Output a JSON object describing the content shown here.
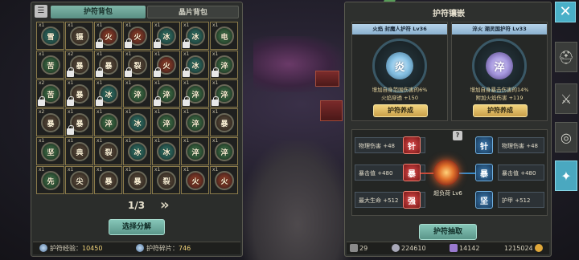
{
  "left_panel": {
    "tabs": [
      {
        "label": "护符背包",
        "active": true
      },
      {
        "label": "晶片背包",
        "active": false
      }
    ],
    "grid": [
      {
        "count": "x1",
        "glyph": "雪",
        "element": "water",
        "locked": false
      },
      {
        "count": "x1",
        "glyph": "镊",
        "element": "dark",
        "locked": false
      },
      {
        "count": "x1",
        "glyph": "火",
        "element": "fire",
        "locked": true
      },
      {
        "count": "x1",
        "glyph": "火",
        "element": "fire",
        "locked": true
      },
      {
        "count": "x1",
        "glyph": "冰",
        "element": "water",
        "locked": true
      },
      {
        "count": "x1",
        "glyph": "冰",
        "element": "water",
        "locked": true
      },
      {
        "count": "x1",
        "glyph": "电",
        "element": "thunder",
        "locked": false
      },
      {
        "count": "x1",
        "glyph": "苦",
        "element": "thunder",
        "locked": false
      },
      {
        "count": "x2",
        "glyph": "暴",
        "element": "dark",
        "locked": true
      },
      {
        "count": "x1",
        "glyph": "暴",
        "element": "dark",
        "locked": true
      },
      {
        "count": "x1",
        "glyph": "裂",
        "element": "dark",
        "locked": true
      },
      {
        "count": "x1",
        "glyph": "火",
        "element": "fire",
        "locked": true
      },
      {
        "count": "x1",
        "glyph": "冰",
        "element": "water",
        "locked": true
      },
      {
        "count": "x1",
        "glyph": "淬",
        "element": "thunder",
        "locked": true
      },
      {
        "count": "x2",
        "glyph": "苦",
        "element": "thunder",
        "locked": true
      },
      {
        "count": "x1",
        "glyph": "暴",
        "element": "dark",
        "locked": true
      },
      {
        "count": "x1",
        "glyph": "冰",
        "element": "water",
        "locked": true
      },
      {
        "count": "x1",
        "glyph": "淬",
        "element": "thunder",
        "locked": false
      },
      {
        "count": "x1",
        "glyph": "淬",
        "element": "thunder",
        "locked": true
      },
      {
        "count": "x1",
        "glyph": "淬",
        "element": "thunder",
        "locked": true
      },
      {
        "count": "x1",
        "glyph": "淬",
        "element": "thunder",
        "locked": true
      },
      {
        "count": "x2",
        "glyph": "暴",
        "element": "dark",
        "locked": false
      },
      {
        "count": "x1",
        "glyph": "暴",
        "element": "dark",
        "locked": true
      },
      {
        "count": "x1",
        "glyph": "淬",
        "element": "thunder",
        "locked": false
      },
      {
        "count": "x1",
        "glyph": "冰",
        "element": "water",
        "locked": false
      },
      {
        "count": "x1",
        "glyph": "淬",
        "element": "thunder",
        "locked": false
      },
      {
        "count": "x1",
        "glyph": "淬",
        "element": "thunder",
        "locked": false
      },
      {
        "count": "x1",
        "glyph": "暴",
        "element": "dark",
        "locked": false
      },
      {
        "count": "x1",
        "glyph": "坚",
        "element": "thunder",
        "locked": false
      },
      {
        "count": "x1",
        "glyph": "典",
        "element": "dark",
        "locked": false
      },
      {
        "count": "x1",
        "glyph": "裂",
        "element": "dark",
        "locked": false
      },
      {
        "count": "x1",
        "glyph": "冰",
        "element": "water",
        "locked": false
      },
      {
        "count": "x1",
        "glyph": "冰",
        "element": "water",
        "locked": false
      },
      {
        "count": "x1",
        "glyph": "淬",
        "element": "thunder",
        "locked": false
      },
      {
        "count": "x1",
        "glyph": "淬",
        "element": "thunder",
        "locked": false
      },
      {
        "count": "x1",
        "glyph": "先",
        "element": "thunder",
        "locked": false
      },
      {
        "count": "x1",
        "glyph": "尖",
        "element": "dark",
        "locked": false
      },
      {
        "count": "x1",
        "glyph": "暴",
        "element": "dark",
        "locked": false
      },
      {
        "count": "x1",
        "glyph": "暴",
        "element": "dark",
        "locked": false
      },
      {
        "count": "x1",
        "glyph": "裂",
        "element": "dark",
        "locked": false
      },
      {
        "count": "x1",
        "glyph": "火",
        "element": "fire",
        "locked": false
      },
      {
        "count": "x1",
        "glyph": "火",
        "element": "fire",
        "locked": false
      }
    ],
    "page_indicator": "1/3",
    "select_button": "选择分解",
    "footer": {
      "exp_label": "护符经验：",
      "exp_value": "10450",
      "shard_label": "护符碎片：",
      "shard_value": "746"
    }
  },
  "right_panel": {
    "title": "护符镶嵌",
    "slots": [
      {
        "name": "火焰 封魔人护符 Lv36",
        "glyph": "炎",
        "effect_1": "增加自身范围伤害的6%",
        "effect_2": "火焰穿透 +150",
        "button": "护符养成"
      },
      {
        "name": "淬火 潮灵国护符 Lv33",
        "glyph": "淬",
        "effect_1": "增加自身暴击伤害的14%",
        "effect_2": "附加火焰伤害 +119",
        "button": "护符养成"
      }
    ],
    "left_stats": [
      "物理伤害 +48",
      "暴击值 +480",
      "最大生命 +512"
    ],
    "right_stats": [
      "物理伤害 +48",
      "暴击值 +480",
      "护甲 +512"
    ],
    "left_runes": [
      "针",
      "暴",
      "强"
    ],
    "right_runes": [
      "针",
      "暴",
      "坚"
    ],
    "core_label": "超负荷 Lv6",
    "help_glyph": "?",
    "draw_button": "护符抽取",
    "currencies": {
      "energy": "29",
      "silver": "224610",
      "crystal": "14142",
      "gold": "1215024"
    }
  },
  "side_nav": {
    "close": "✕",
    "items": [
      {
        "icon": "helmet-icon",
        "glyph": "⛑"
      },
      {
        "icon": "crossed-swords-icon",
        "glyph": "⚔"
      },
      {
        "icon": "shield-target-icon",
        "glyph": "◎"
      },
      {
        "icon": "amulet-icon",
        "glyph": "✦"
      }
    ]
  },
  "colors": {
    "accent_teal": "#5b968a",
    "button_gold": "#c9a04a",
    "close_blue": "#4ab0c8"
  }
}
